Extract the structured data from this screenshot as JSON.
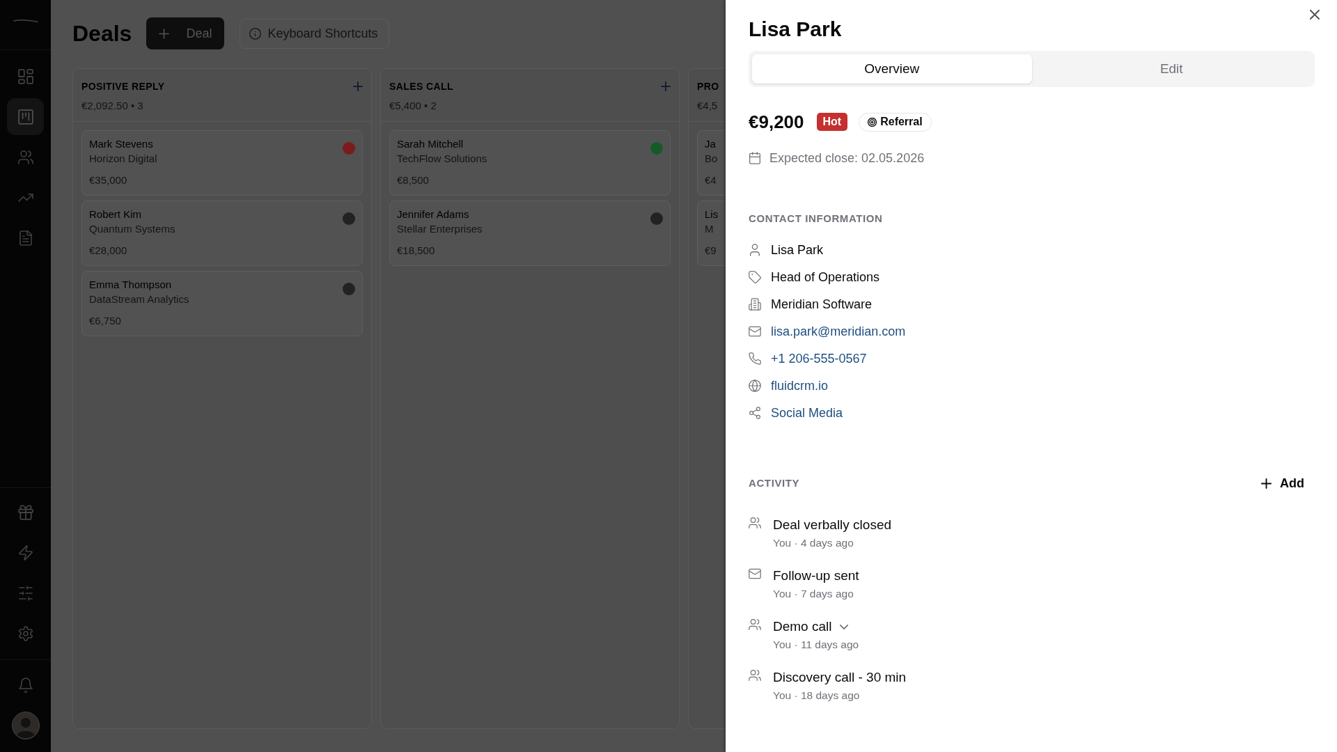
{
  "sidebar": {
    "nav": [
      {
        "selected": false
      },
      {
        "selected": true
      },
      {
        "selected": false
      },
      {
        "selected": false
      },
      {
        "selected": false
      }
    ]
  },
  "header": {
    "title": "Deals",
    "new_button": "Deal",
    "shortcuts_button": "Keyboard Shortcuts"
  },
  "board": {
    "columns": [
      {
        "title": "POSITIVE REPLY",
        "summary": "€2,092.50 • 3",
        "add_button": true,
        "cards": [
          {
            "name": "Mark Stevens",
            "company": "Horizon Digital",
            "amount": "€35,000",
            "color": "#7a1c1c"
          },
          {
            "name": "Robert Kim",
            "company": "Quantum Systems",
            "amount": "€28,000",
            "color": "#222222"
          },
          {
            "name": "Emma Thompson",
            "company": "DataStream Analytics",
            "amount": "€6,750",
            "color": "#222222"
          }
        ]
      },
      {
        "title": "SALES CALL",
        "summary": "€5,400 • 2",
        "add_button": true,
        "cards": [
          {
            "name": "Sarah Mitchell",
            "company": "TechFlow Solutions",
            "amount": "€8,500",
            "color": "#175a29"
          },
          {
            "name": "Jennifer Adams",
            "company": "Stellar Enterprises",
            "amount": "€18,500",
            "color": "#222222"
          }
        ]
      },
      {
        "title": "PRO",
        "summary": "€4,5",
        "add_button": false,
        "cards": [
          {
            "name": "Ja",
            "company": "Bo",
            "amount": "€4"
          },
          {
            "name": "Lis",
            "company": "M",
            "amount": "€9"
          }
        ]
      }
    ]
  },
  "panel": {
    "title": "Lisa Park",
    "tabs": [
      {
        "label": "Overview",
        "selected": true
      },
      {
        "label": "Edit",
        "selected": false
      }
    ],
    "amount": "€9,200",
    "badges": [
      {
        "kind": "priority",
        "label": "Hot"
      },
      {
        "kind": "source",
        "label": "Referral"
      }
    ],
    "expected_close": "Expected close: 02.05.2026",
    "contact": {
      "heading": "CONTACT INFORMATION",
      "rows": [
        {
          "kind": "name",
          "text": "Lisa Park"
        },
        {
          "kind": "title",
          "text": "Head of Operations"
        },
        {
          "kind": "company",
          "text": "Meridian Software"
        },
        {
          "kind": "email",
          "text": "lisa.park@meridian.com"
        },
        {
          "kind": "phone",
          "text": "+1 206-555-0567"
        },
        {
          "kind": "website",
          "text": "fluidcrm.io"
        },
        {
          "kind": "social",
          "text": "Social Media"
        }
      ]
    },
    "activity": {
      "heading": "ACTIVITY",
      "add_button": "Add",
      "items": [
        {
          "kind": "meeting",
          "title": "Deal verbally closed",
          "meta": "You · 4 days ago",
          "expandable": false
        },
        {
          "kind": "email",
          "title": "Follow-up sent",
          "meta": "You · 7 days ago",
          "expandable": false
        },
        {
          "kind": "meeting",
          "title": "Demo call",
          "meta": "You · 11 days ago",
          "expandable": true
        },
        {
          "kind": "meeting",
          "title": "Discovery call - 30 min",
          "meta": "You · 18 days ago",
          "expandable": false
        }
      ]
    }
  }
}
